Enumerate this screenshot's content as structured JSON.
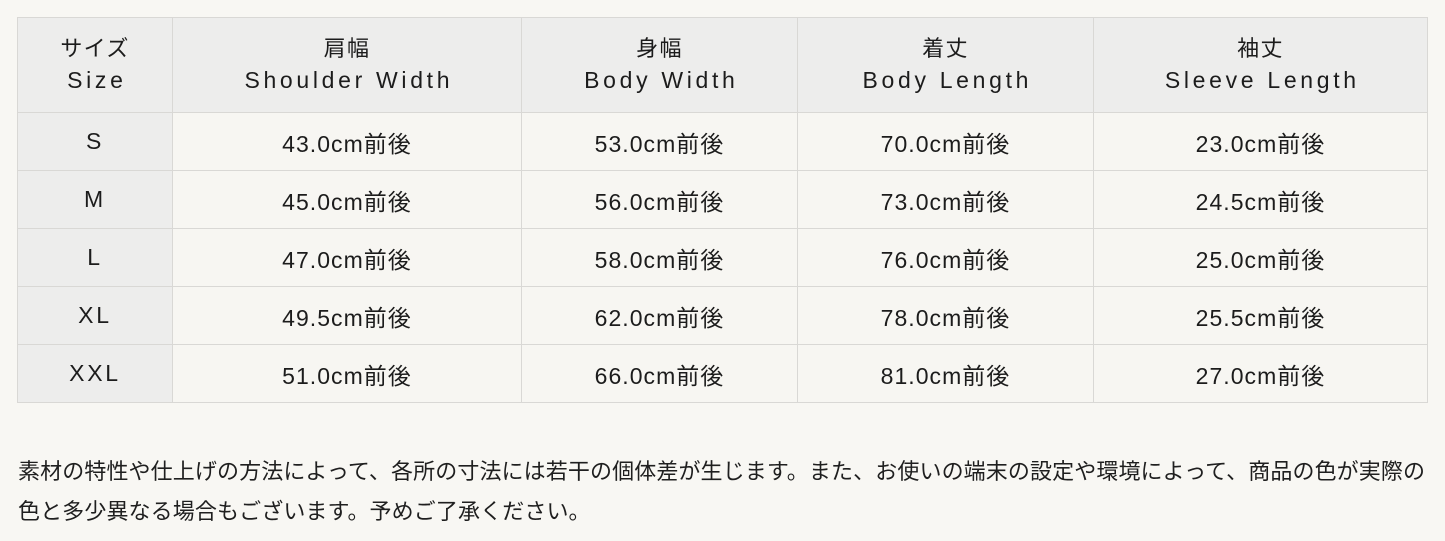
{
  "table": {
    "columns": [
      {
        "ja": "サイズ",
        "en": "Size"
      },
      {
        "ja": "肩幅",
        "en": "Shoulder Width"
      },
      {
        "ja": "身幅",
        "en": "Body Width"
      },
      {
        "ja": "着丈",
        "en": "Body Length"
      },
      {
        "ja": "袖丈",
        "en": "Sleeve Length"
      }
    ],
    "rows": [
      {
        "size": "S",
        "shoulder_width": "43.0cm前後",
        "body_width": "53.0cm前後",
        "body_length": "70.0cm前後",
        "sleeve_length": "23.0cm前後"
      },
      {
        "size": "M",
        "shoulder_width": "45.0cm前後",
        "body_width": "56.0cm前後",
        "body_length": "73.0cm前後",
        "sleeve_length": "24.5cm前後"
      },
      {
        "size": "L",
        "shoulder_width": "47.0cm前後",
        "body_width": "58.0cm前後",
        "body_length": "76.0cm前後",
        "sleeve_length": "25.0cm前後"
      },
      {
        "size": "XL",
        "shoulder_width": "49.5cm前後",
        "body_width": "62.0cm前後",
        "body_length": "78.0cm前後",
        "sleeve_length": "25.5cm前後"
      },
      {
        "size": "XXL",
        "shoulder_width": "51.0cm前後",
        "body_width": "66.0cm前後",
        "body_length": "81.0cm前後",
        "sleeve_length": "27.0cm前後"
      }
    ]
  },
  "footnote": {
    "line1": "素材の特性や仕上げの方法によって、各所の寸法には若干の個体差が生じます。また、お使いの端末の設定や環境によっ",
    "line2": "て、商品の色が実際の色と多少異なる場合もございます。予めご了承ください。"
  },
  "colors": {
    "page_background": "#f8f7f3",
    "header_cell_background": "#ededec",
    "size_cell_background": "#ededec",
    "value_cell_background": "#f7f6f2",
    "border": "#d9d8d5",
    "text": "#1c1c1c"
  }
}
